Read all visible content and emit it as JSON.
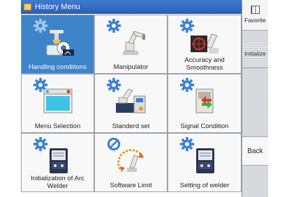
{
  "window": {
    "title": "History Menu"
  },
  "tiles": [
    {
      "label": "Handling conditions",
      "icon": "handling-conditions-icon",
      "selected": true
    },
    {
      "label": "Manipulator",
      "icon": "manipulator-icon"
    },
    {
      "label": "Accuracy and Smoothness",
      "icon": "accuracy-smoothness-icon"
    },
    {
      "label": "Menu Selection",
      "icon": "menu-selection-icon"
    },
    {
      "label": "Standerd set",
      "icon": "standard-set-icon"
    },
    {
      "label": "Signal Condition",
      "icon": "signal-condition-icon"
    },
    {
      "label": "Initialization of Arc Welder",
      "icon": "arc-welder-icon"
    },
    {
      "label": "Software Limit",
      "icon": "software-limit-icon"
    },
    {
      "label": "Setting of welder",
      "icon": "welder-setting-icon"
    }
  ],
  "side": {
    "favorite": "Favorite",
    "initialize": "Initialize",
    "back": "Back"
  },
  "colors": {
    "titlebar": "#2f66bf",
    "selected_tile": "#3d84c9",
    "gear": "#3b82d6"
  }
}
